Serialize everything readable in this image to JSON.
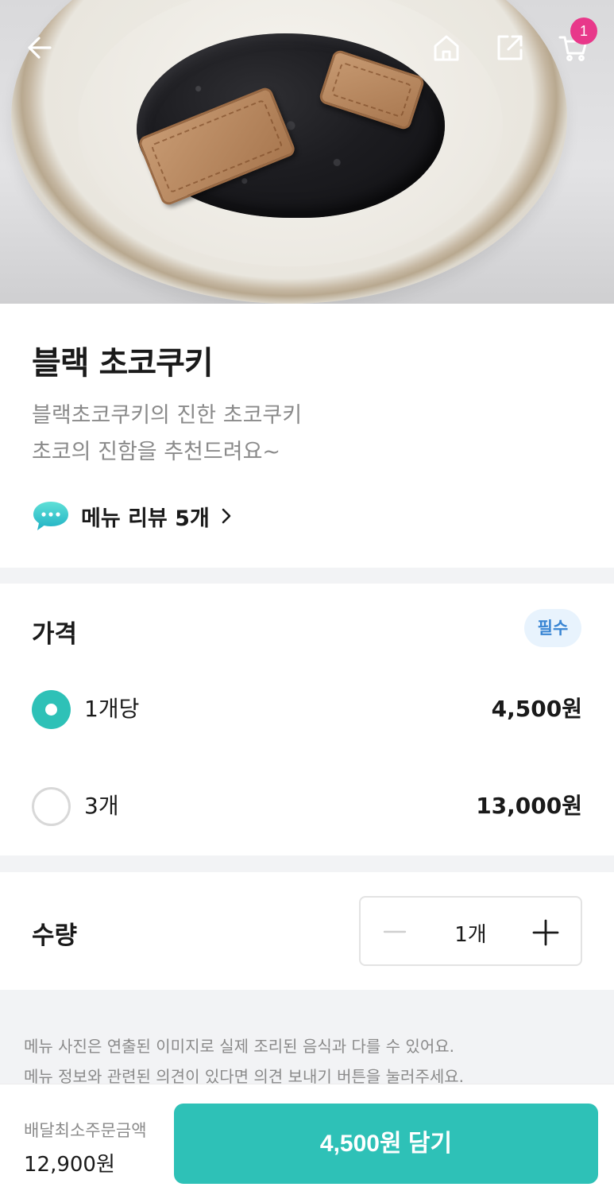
{
  "header": {
    "cart_count": "1",
    "icons": [
      "arrow-left-icon",
      "home-icon",
      "share-icon",
      "cart-icon"
    ]
  },
  "menu": {
    "title": "블랙 초코쿠키",
    "description_lines": [
      "블랙초코쿠키의 진한 초코쿠키",
      "초코의 진함을 추천드려요~"
    ],
    "review_label": "메뉴 리뷰 5개"
  },
  "price_section": {
    "title": "가격",
    "required_badge": "필수",
    "options": [
      {
        "label": "1개당",
        "price": "4,500원",
        "selected": true
      },
      {
        "label": "3개",
        "price": "13,000원",
        "selected": false
      }
    ]
  },
  "quantity": {
    "title": "수량",
    "value": "1개"
  },
  "notice": {
    "lines": [
      "메뉴 사진은 연출된 이미지로 실제 조리된 음식과 다를 수 있어요.",
      "메뉴 정보와 관련된 의견이 있다면 의견 보내기 버튼을 눌러주세요."
    ]
  },
  "footer": {
    "min_order_label": "배달최소주문금액",
    "min_order_value": "12,900원",
    "add_button": "4,500원 담기"
  },
  "colors": {
    "accent": "#2ec1b7",
    "badge_pink": "#e8388a",
    "required_blue": "#3a86d4"
  }
}
